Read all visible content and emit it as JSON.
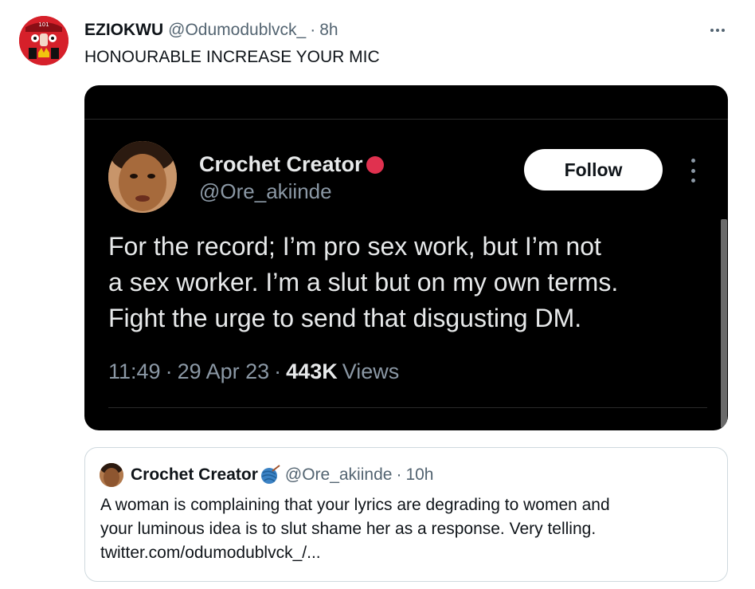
{
  "tweet": {
    "author_name": "EZIOKWU",
    "author_handle": "@Odumodublvck_",
    "separator": "·",
    "time": "8h",
    "text": "HONOURABLE INCREASE YOUR MIC",
    "more_icon": "more-horizontal-icon"
  },
  "screenshot": {
    "author_name": "Crochet Creator",
    "author_handle": "@Ore_akiinde",
    "badge_icon": "yarn-ball-icon",
    "follow_label": "Follow",
    "text_lines": [
      "For the record; I’m pro sex work, but I’m not",
      "a sex worker. I’m a slut but on my own terms.",
      "Fight the urge to send that disgusting DM."
    ],
    "time": "11:49",
    "date": "29 Apr 23",
    "views_count": "443K",
    "views_label": "Views",
    "separator": "·"
  },
  "quote": {
    "author_name": "Crochet Creator",
    "badge_icon": "yarn-ball-icon",
    "author_handle": "@Ore_akiinde",
    "separator": "·",
    "time": "10h",
    "text_lines": [
      "A woman is complaining that your lyrics are degrading to women and",
      "your luminous idea is to slut shame her as a response. Very telling.",
      "twitter.com/odumodublvck_/..."
    ]
  },
  "colors": {
    "text_primary": "#0f1419",
    "text_secondary": "#536471",
    "dark_bg": "#000000",
    "dark_text": "#e7e9ea",
    "border": "#cfd9de",
    "avatar_red": "#d6202a"
  }
}
